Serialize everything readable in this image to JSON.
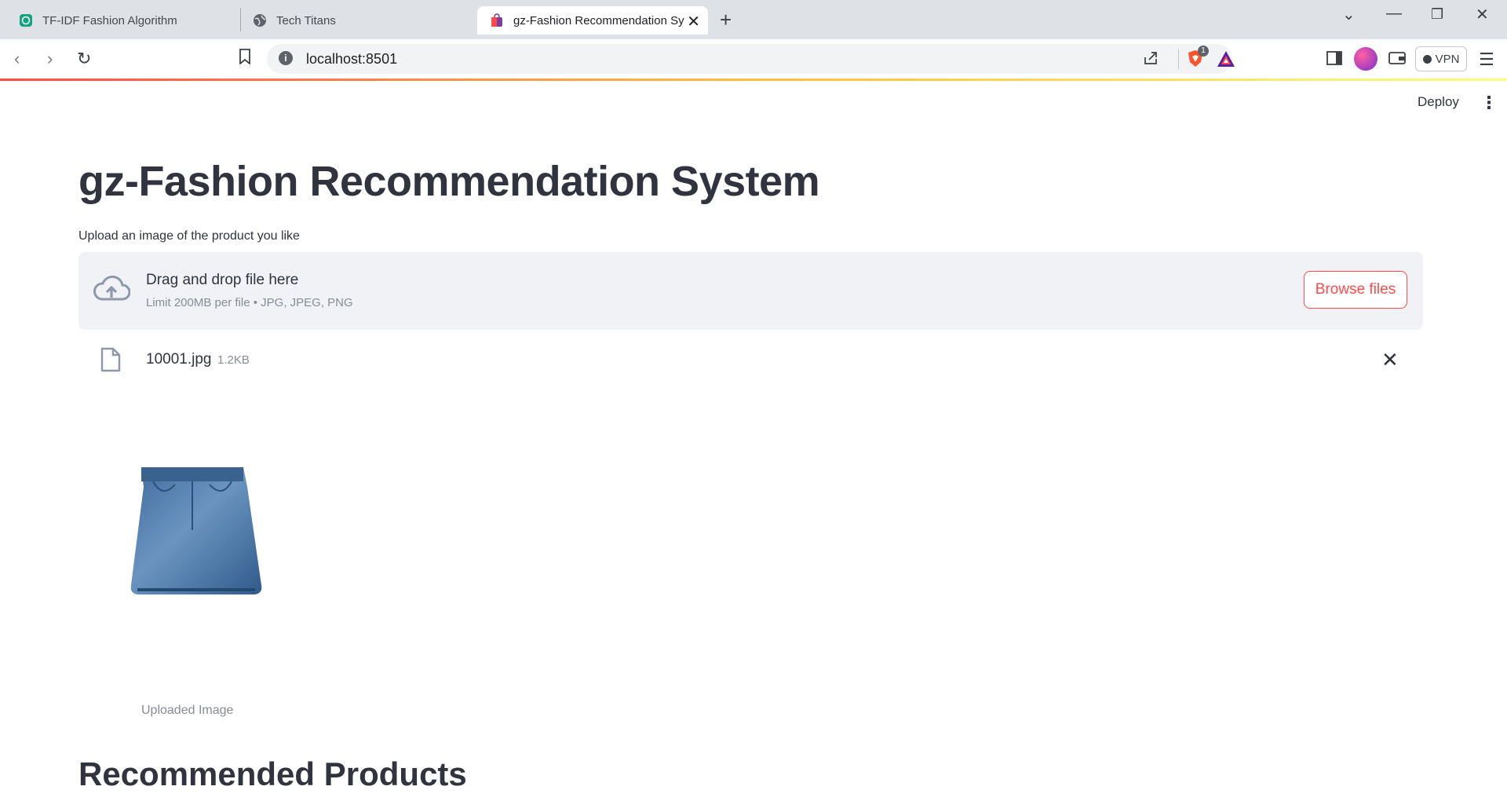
{
  "browser": {
    "tabs": [
      {
        "title": "TF-IDF Fashion Algorithm",
        "icon": "openai-icon"
      },
      {
        "title": "Tech Titans",
        "icon": "globe-icon"
      },
      {
        "title": "gz-Fashion Recommendation Sy",
        "icon": "streamlit-icon",
        "active": true
      }
    ],
    "url": "localhost:8501",
    "vpn_label": "VPN",
    "brave_badge": "1"
  },
  "app": {
    "deploy_label": "Deploy",
    "title": "gz-Fashion Recommendation System",
    "uploader": {
      "label": "Upload an image of the product you like",
      "drop_text": "Drag and drop file here",
      "limit_text": "Limit 200MB per file • JPG, JPEG, PNG",
      "browse_label": "Browse files"
    },
    "file": {
      "name": "10001.jpg",
      "size": "1.2KB"
    },
    "image_caption": "Uploaded Image",
    "recommended_heading": "Recommended Products"
  },
  "colors": {
    "accent": "#ff4b4b",
    "text": "#31333f",
    "dropzone_bg": "#f0f2f6"
  }
}
